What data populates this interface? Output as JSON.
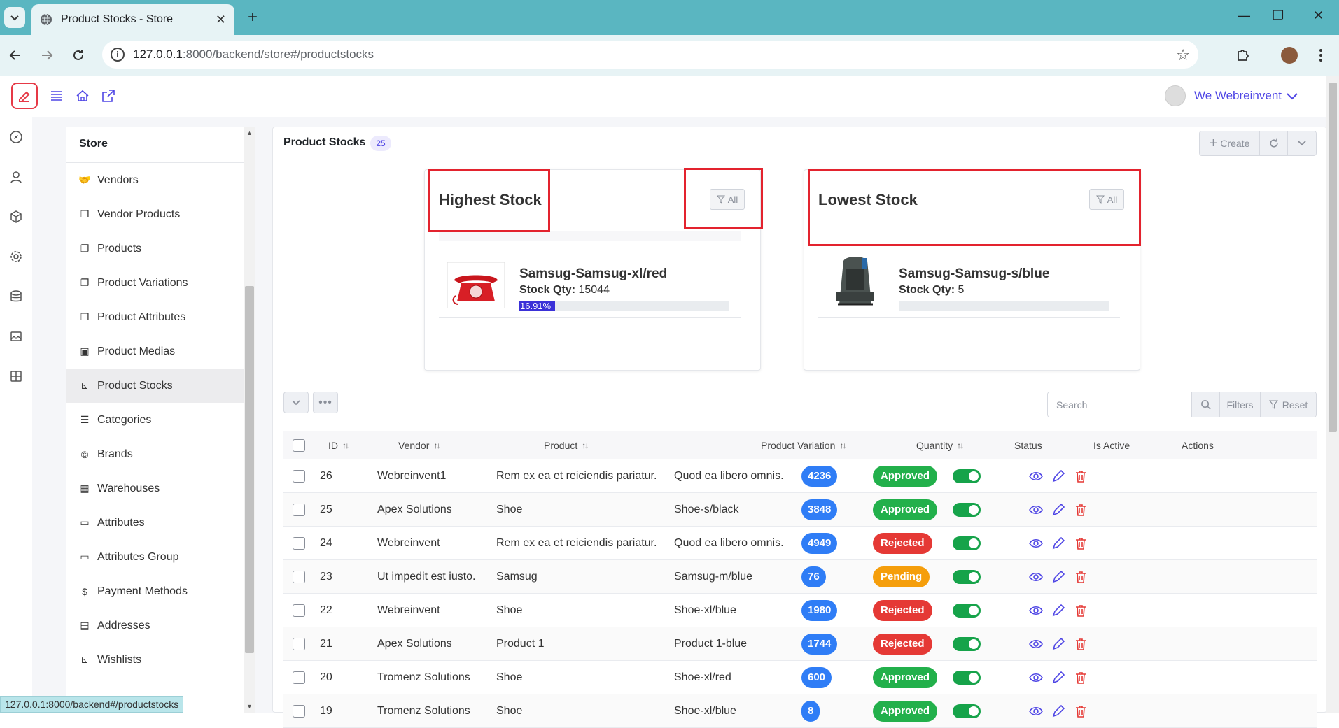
{
  "browser": {
    "tab_title": "Product Stocks - Store",
    "url_host": "127.0.0.1",
    "url_path": ":8000/backend/store#/productstocks",
    "status_url": "127.0.0.1:8000/backend#/productstocks"
  },
  "header": {
    "user_name": "We Webreinvent"
  },
  "sidebar": {
    "title": "Store",
    "items": [
      {
        "label": "Vendors",
        "icon": "handshake-icon"
      },
      {
        "label": "Vendor Products",
        "icon": "copy-icon"
      },
      {
        "label": "Products",
        "icon": "copy-icon"
      },
      {
        "label": "Product Variations",
        "icon": "copy-icon"
      },
      {
        "label": "Product Attributes",
        "icon": "copy-icon"
      },
      {
        "label": "Product Medias",
        "icon": "image-icon"
      },
      {
        "label": "Product Stocks",
        "icon": "chart-icon",
        "active": true
      },
      {
        "label": "Categories",
        "icon": "list-icon"
      },
      {
        "label": "Brands",
        "icon": "copyright-icon"
      },
      {
        "label": "Warehouses",
        "icon": "building-icon"
      },
      {
        "label": "Attributes",
        "icon": "folder-icon"
      },
      {
        "label": "Attributes Group",
        "icon": "folder-icon"
      },
      {
        "label": "Payment Methods",
        "icon": "dollar-icon"
      },
      {
        "label": "Addresses",
        "icon": "address-card-icon"
      },
      {
        "label": "Wishlists",
        "icon": "chart-icon"
      }
    ]
  },
  "main": {
    "title": "Product Stocks",
    "count": "25",
    "create_label": "Create"
  },
  "highest_card": {
    "title": "Highest Stock",
    "filter_label": "All",
    "item_name": "Samsug-Samsug-xl/red",
    "qty_label": "Stock Qty:",
    "qty_value": "15044",
    "progress_text": "16.91%",
    "progress": 16.91
  },
  "lowest_card": {
    "title": "Lowest Stock",
    "filter_label": "All",
    "item_name": "Samsug-Samsug-s/blue",
    "qty_label": "Stock Qty:",
    "qty_value": "5",
    "progress": 0
  },
  "toolbar": {
    "search_placeholder": "Search",
    "filters_label": "Filters",
    "reset_label": "Reset"
  },
  "table": {
    "columns": [
      "ID",
      "Vendor",
      "Product",
      "Product Variation",
      "Quantity",
      "Status",
      "Is Active",
      "Actions"
    ],
    "rows": [
      {
        "id": "26",
        "vendor": "Webreinvent1",
        "product": "Rem ex ea et reiciendis pariatur.",
        "variation": "Quod ea libero omnis.",
        "qty": "4236",
        "status": "Approved"
      },
      {
        "id": "25",
        "vendor": "Apex Solutions",
        "product": "Shoe",
        "variation": "Shoe-s/black",
        "qty": "3848",
        "status": "Approved"
      },
      {
        "id": "24",
        "vendor": "Webreinvent",
        "product": "Rem ex ea et reiciendis pariatur.",
        "variation": "Quod ea libero omnis.",
        "qty": "4949",
        "status": "Rejected"
      },
      {
        "id": "23",
        "vendor": "Ut impedit est iusto.",
        "product": "Samsug",
        "variation": "Samsug-m/blue",
        "qty": "76",
        "status": "Pending"
      },
      {
        "id": "22",
        "vendor": "Webreinvent",
        "product": "Shoe",
        "variation": "Shoe-xl/blue",
        "qty": "1980",
        "status": "Rejected"
      },
      {
        "id": "21",
        "vendor": "Apex Solutions",
        "product": "Product 1",
        "variation": "Product 1-blue",
        "qty": "1744",
        "status": "Rejected"
      },
      {
        "id": "20",
        "vendor": "Tromenz Solutions",
        "product": "Shoe",
        "variation": "Shoe-xl/red",
        "qty": "600",
        "status": "Approved"
      },
      {
        "id": "19",
        "vendor": "Tromenz Solutions",
        "product": "Shoe",
        "variation": "Shoe-xl/blue",
        "qty": "8",
        "status": "Approved"
      }
    ]
  },
  "colors": {
    "approved": "#22b04b",
    "rejected": "#e53935",
    "pending": "#f59e0b",
    "qty": "#2f7df6",
    "accent": "#4f46e5",
    "highlight": "#e3232e"
  }
}
